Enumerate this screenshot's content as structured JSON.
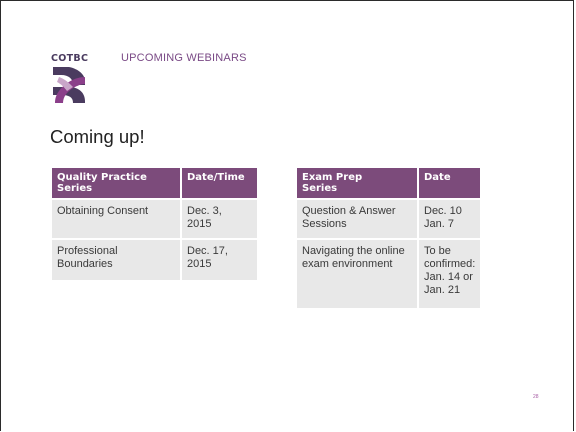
{
  "brand": {
    "logo_text": "COTBC"
  },
  "header": {
    "section_title": "UPCOMING WEBINARS"
  },
  "slide": {
    "heading": "Coming up!",
    "page_number": "28"
  },
  "tables": {
    "quality": {
      "headers": [
        "Quality Practice\nSeries",
        "Date/Time"
      ],
      "rows": [
        [
          "Obtaining Consent",
          "Dec. 3,\n2015"
        ],
        [
          "Professional\nBoundaries",
          "Dec. 17,\n2015"
        ]
      ]
    },
    "exam": {
      "headers": [
        "Exam Prep\nSeries",
        "Date"
      ],
      "rows": [
        [
          "Question & Answer\nSessions",
          "Dec. 10\nJan. 7"
        ],
        [
          "Navigating the online\nexam environment",
          "To be\nconfirmed:\nJan. 14 or\nJan. 21"
        ]
      ]
    }
  },
  "colors": {
    "table_header": "#7c4b7b",
    "table_cell": "#e8e8e8",
    "section_title": "#7a4a86",
    "logo_dark": "#4a3b5f",
    "logo_purple": "#8b3f8a"
  }
}
